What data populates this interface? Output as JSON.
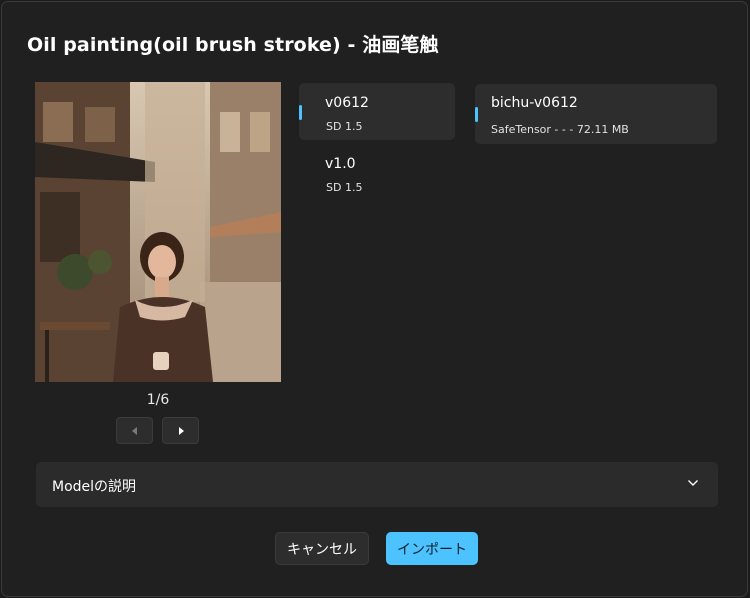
{
  "dialog": {
    "title": "Oil painting(oil brush stroke) - 油画笔触"
  },
  "preview": {
    "image_alt": "oil painting of woman holding cup in street cafe",
    "counter": "1/6"
  },
  "versions": [
    {
      "name": "v0612",
      "base": "SD 1.5",
      "selected": true
    },
    {
      "name": "v1.0",
      "base": "SD 1.5",
      "selected": false
    }
  ],
  "file": {
    "name": "bichu-v0612",
    "meta": "SafeTensor - - - 72.11 MB"
  },
  "expander": {
    "label": "Modelの説明"
  },
  "buttons": {
    "cancel": "キャンセル",
    "import": "インポート"
  },
  "colors": {
    "accent": "#4cc2ff",
    "background": "#202020",
    "card": "#2d2d2d"
  }
}
